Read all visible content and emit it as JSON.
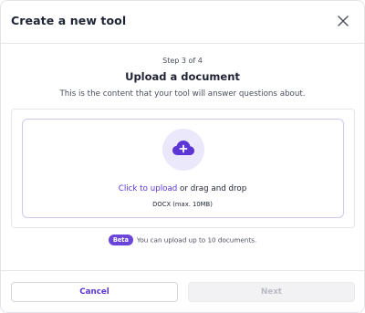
{
  "header": {
    "title": "Create a new tool",
    "close_icon": "close-icon"
  },
  "step": {
    "label": "Step 3 of 4"
  },
  "main": {
    "heading": "Upload a document",
    "description": "This is the content that your tool will answer questions about."
  },
  "dropzone": {
    "icon": "cloud-upload-icon",
    "link_text": "Click to upload",
    "rest_text": " or drag and drop",
    "formats": "DOCX (max. 10MB)"
  },
  "beta": {
    "badge": "Beta",
    "text": "You can upload up to 10 documents."
  },
  "footer": {
    "cancel_label": "Cancel",
    "next_label": "Next"
  },
  "colors": {
    "accent": "#5b35d5",
    "badge": "#6b45d9",
    "icon_bg": "#ece8fb"
  }
}
